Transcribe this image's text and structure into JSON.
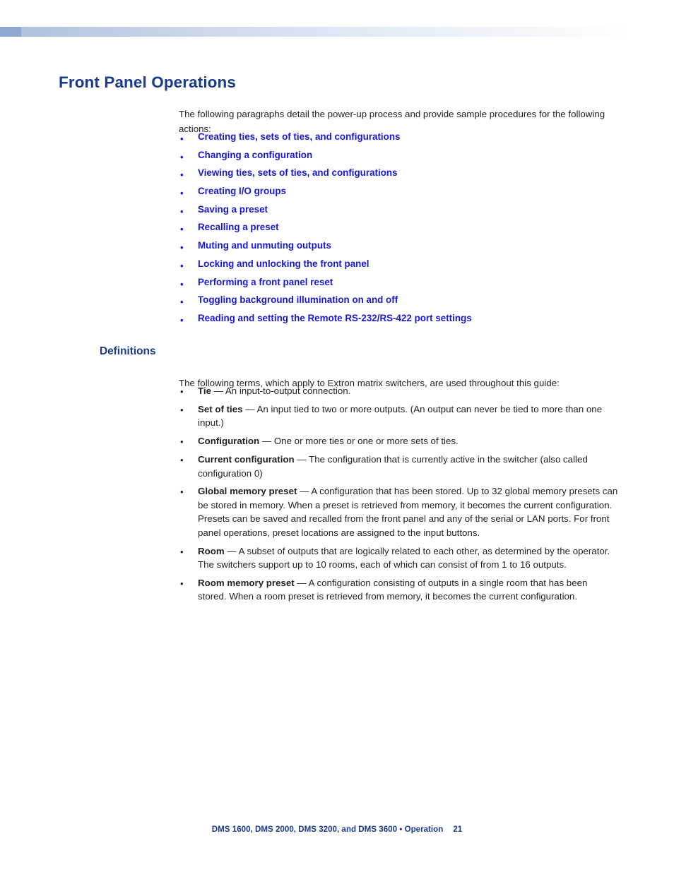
{
  "colors": {
    "heading_blue": "#1a3a8f",
    "link_blue": "#1717d8",
    "body_text": "#231f20",
    "band_dark": "#8fa8cf"
  },
  "page_title": "Front Panel Operations",
  "intro": "The following paragraphs detail the power-up process and provide sample procedures for the following actions:",
  "links": [
    {
      "label": "Creating ties, sets of ties, and configurations"
    },
    {
      "label": "Changing a configuration"
    },
    {
      "label": "Viewing ties, sets of ties, and configurations"
    },
    {
      "label": "Creating I/O groups"
    },
    {
      "label": "Saving a preset"
    },
    {
      "label": "Recalling a preset"
    },
    {
      "label": "Muting and unmuting outputs"
    },
    {
      "label": "Locking and unlocking the front panel"
    },
    {
      "label": "Performing a front panel reset"
    },
    {
      "label": "Toggling background illumination on and off"
    },
    {
      "label": "Reading and setting the Remote RS-232/RS-422 port settings"
    }
  ],
  "section": {
    "title": "Definitions",
    "intro": "The following terms, which apply to Extron matrix switchers, are used throughout this guide:",
    "definitions": [
      {
        "term": "Tie",
        "text": " — An input-to-output connection."
      },
      {
        "term": "Set of ties",
        "text": " — An input tied to two or more outputs. (An output can never be tied to more than one input.)"
      },
      {
        "term": "Configuration",
        "text": " — One or more ties or one or more sets of ties."
      },
      {
        "term": "Current configuration",
        "text": " — The configuration that is currently active in the switcher (also called configuration 0)"
      },
      {
        "term": "Global memory preset",
        "text": " — A configuration that has been stored. Up to 32 global memory presets can be stored in memory. When a preset is retrieved from memory, it becomes the current configuration. Presets can be saved and recalled from the front panel and any of the serial or LAN ports. For front panel operations, preset locations are assigned to the input buttons."
      },
      {
        "term": "Room",
        "text": " — A subset of outputs that are logically related to each other, as determined by the operator. The switchers support up to 10 rooms, each of which can consist of from 1 to 16 outputs."
      },
      {
        "term": "Room memory preset",
        "text": " — A configuration consisting of outputs in a single room that has been stored. When a room preset is retrieved from memory, it becomes the current configuration."
      }
    ]
  },
  "footer": {
    "text": "DMS 1600, DMS 2000, DMS 3200, and DMS 3600 • Operation",
    "page_number": "21"
  },
  "bullet_glyph": "•"
}
